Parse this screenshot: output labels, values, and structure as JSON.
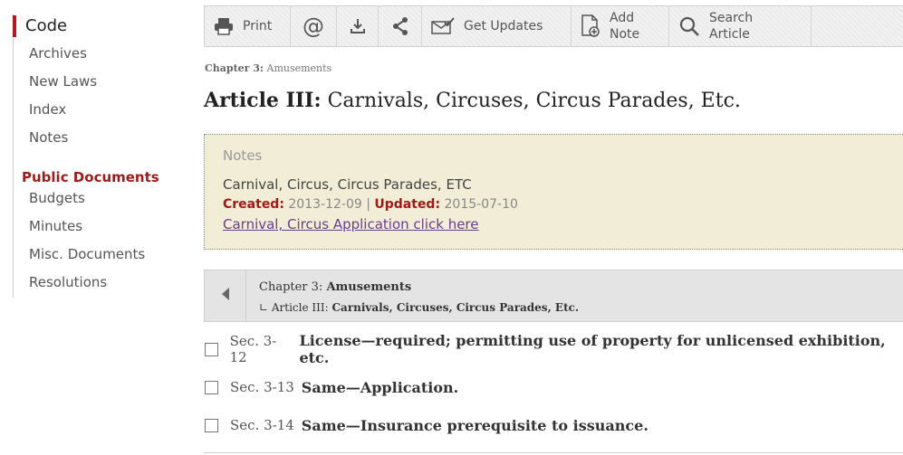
{
  "sidebar": {
    "active": "Code",
    "items": [
      "Archives",
      "New Laws",
      "Index",
      "Notes"
    ],
    "section_title": "Public Documents",
    "section_items": [
      "Budgets",
      "Minutes",
      "Misc. Documents",
      "Resolutions"
    ]
  },
  "toolbar": {
    "print": "Print",
    "get_updates": "Get Updates",
    "add_note_1": "Add",
    "add_note_2": "Note",
    "search_1": "Search",
    "search_2": "Article"
  },
  "breadcrumb": {
    "chapter_label": "Chapter 3:",
    "chapter_name": "Amusements"
  },
  "article": {
    "label": "Article III:",
    "title": "Carnivals, Circuses, Circus Parades, Etc."
  },
  "notes": {
    "heading": "Notes",
    "text": "Carnival, Circus, Circus Parades, ETC",
    "created_label": "Created:",
    "created": "2013-12-09",
    "separator": "|",
    "updated_label": "Updated:",
    "updated": "2015-07-10",
    "link": "Carnival, Circus Application click here"
  },
  "nav": {
    "chapter_label": "Chapter 3:",
    "chapter_name": "Amusements",
    "article_prefix": "∟ Article III:",
    "article_name": "Carnivals, Circuses, Circus Parades, Etc."
  },
  "sections": [
    {
      "num": "Sec. 3-12",
      "title": "License—required; permitting use of property for unlicensed exhibition, etc."
    },
    {
      "num": "Sec. 3-13",
      "title": "Same—Application."
    },
    {
      "num": "Sec. 3-14",
      "title": "Same—Insurance prerequisite to issuance."
    }
  ],
  "colors": {
    "accent": "#b31b1b",
    "notes_bg": "#f1edd6",
    "link": "#6a3d8f"
  }
}
